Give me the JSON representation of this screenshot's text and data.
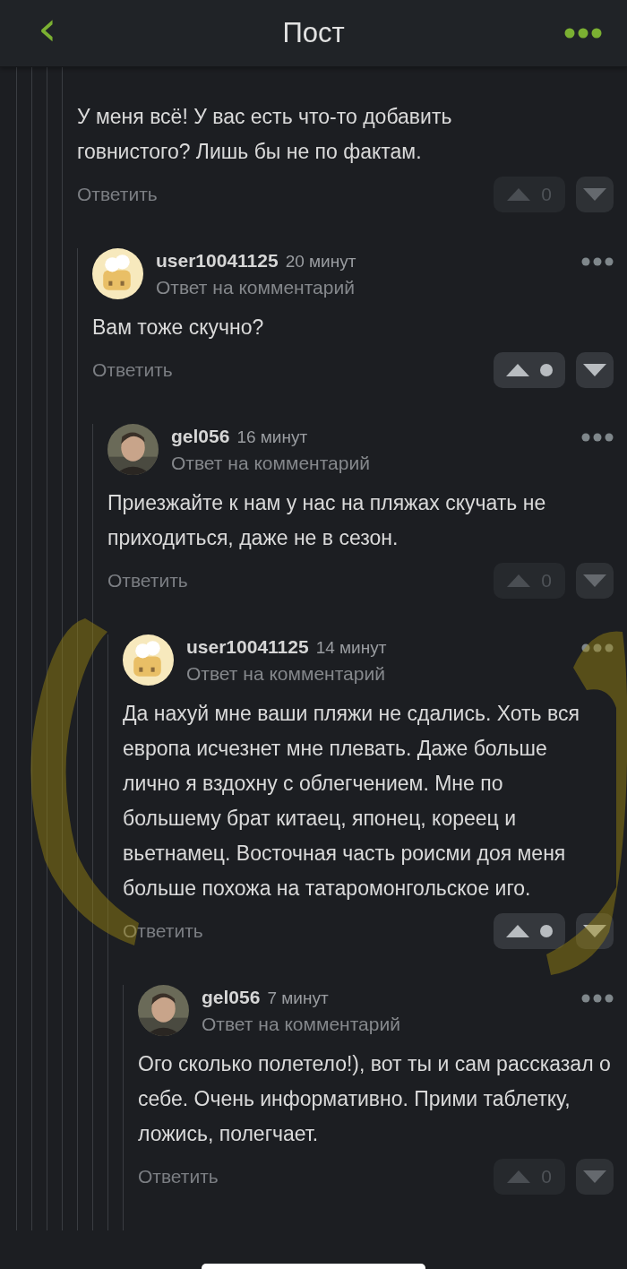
{
  "header": {
    "back": "‹",
    "title": "Пост"
  },
  "comments": [
    {
      "body": "У меня всё! У вас есть что-то добавить говнистого? Лишь бы не по фактам.",
      "reply": "Ответить",
      "vote": {
        "hidden": false,
        "rating": "0"
      },
      "children": [
        {
          "avatar": {
            "kind": "cartoon"
          },
          "author": "user10041125",
          "time": "20 минут",
          "subtitle": "Ответ на комментарий",
          "body": "Вам тоже скучно?",
          "reply": "Ответить",
          "vote": {
            "hidden": true
          },
          "children": [
            {
              "author": "gel056",
              "time": "16 минут",
              "subtitle": "Ответ на комментарий",
              "body": "Приезжайте к нам у нас на пляжах скучать не приходиться, даже не в сезон.",
              "reply": "Ответить",
              "vote": {
                "hidden": false,
                "rating": "0"
              },
              "children": [
                {
                  "avatar": {
                    "kind": "cartoon"
                  },
                  "author": "user10041125",
                  "time": "14 минут",
                  "subtitle": "Ответ на комментарий",
                  "body": "Да нахуй мне ваши пляжи не сдались. Хоть вся европа исчезнет мне плевать. Даже больше лично я вздохну с облегчением. Мне по большему брат китаец, японец, кореец и вьетнамец. Восточная часть роисми доя меня больше похожа на татаромонгольское иго.",
                  "reply": "Ответить",
                  "vote": {
                    "hidden": true
                  },
                  "children": [
                    {
                      "author": "gel056",
                      "time": "7 минут",
                      "subtitle": "Ответ на комментарий",
                      "body": "Ого сколько полетело!), вот ты и сам рассказал о себе. Очень информативно. Прими таблетку, ложись, полегчает.",
                      "reply": "Ответить",
                      "vote": {
                        "hidden": false,
                        "rating": "0"
                      }
                    }
                  ]
                }
              ]
            }
          ]
        }
      ]
    }
  ]
}
